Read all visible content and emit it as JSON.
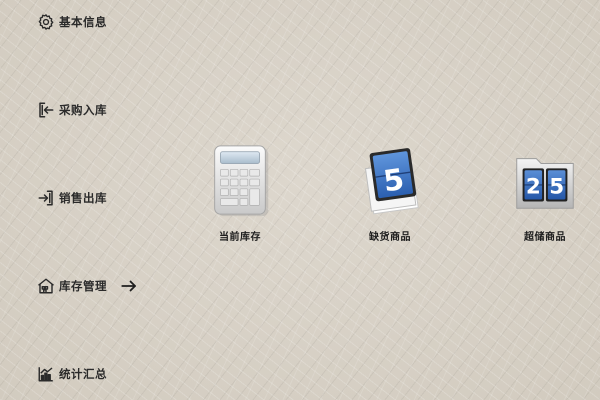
{
  "sidebar": {
    "items": [
      {
        "label": "基本信息",
        "icon": "gear-icon"
      },
      {
        "label": "采购入库",
        "icon": "login-arrow-icon"
      },
      {
        "label": "销售出库",
        "icon": "logout-arrow-icon"
      },
      {
        "label": "库存管理",
        "icon": "warehouse-icon"
      },
      {
        "label": "统计汇总",
        "icon": "bar-chart-icon"
      }
    ],
    "active_indicator_icon": "arrow-right-icon"
  },
  "main": {
    "tiles": [
      {
        "label": "当前库存",
        "icon": "calculator-icon"
      },
      {
        "label": "缺货商品",
        "icon": "flip-calendar-icon",
        "digits": "5"
      },
      {
        "label": "超储商品",
        "icon": "folder-calendar-icon",
        "digits": [
          "2",
          "5"
        ]
      }
    ]
  },
  "colors": {
    "text": "#2a2a2a",
    "tile_blue": "#3a73c6",
    "background": "#d8d1c6"
  }
}
